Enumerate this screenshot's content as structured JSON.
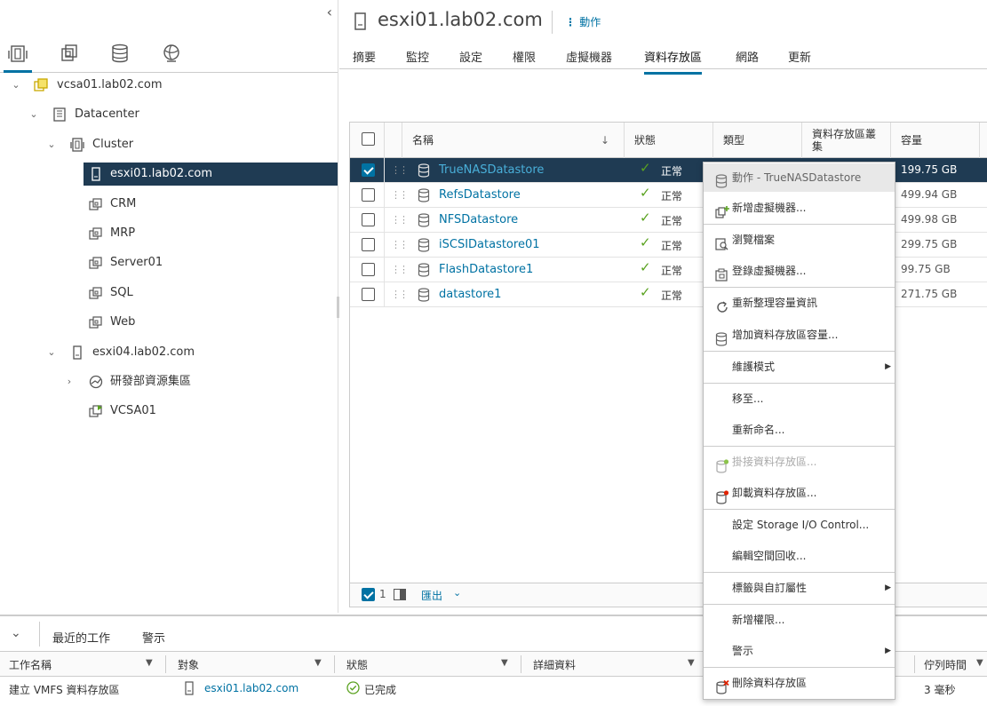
{
  "header": {
    "title": "esxi01.lab02.com",
    "actions_label": "動作"
  },
  "main_tabs": [
    "摘要",
    "監控",
    "設定",
    "權限",
    "虛擬機器",
    "資料存放區",
    "網路",
    "更新"
  ],
  "active_tab": "資料存放區",
  "tree": [
    {
      "label": "vcsa01.lab02.com",
      "icon": "vcenter-icon",
      "level": 0,
      "expanded": true
    },
    {
      "label": "Datacenter",
      "icon": "datacenter-icon",
      "level": 1,
      "expanded": true
    },
    {
      "label": "Cluster",
      "icon": "cluster-icon",
      "level": 2,
      "expanded": true
    },
    {
      "label": "esxi01.lab02.com",
      "icon": "host-icon",
      "level": 3,
      "selected": true
    },
    {
      "label": "CRM",
      "icon": "vm-icon",
      "level": 3
    },
    {
      "label": "MRP",
      "icon": "vm-icon",
      "level": 3
    },
    {
      "label": "Server01",
      "icon": "vm-icon",
      "level": 3
    },
    {
      "label": "SQL",
      "icon": "vm-icon",
      "level": 3
    },
    {
      "label": "Web",
      "icon": "vm-icon",
      "level": 3
    },
    {
      "label": "esxi04.lab02.com",
      "icon": "host-icon",
      "level": 2,
      "expanded": true
    },
    {
      "label": "研發部資源集區",
      "icon": "resource-pool-icon",
      "level": 3,
      "collapsed": true
    },
    {
      "label": "VCSA01",
      "icon": "vm-powered-on-icon",
      "level": 3
    }
  ],
  "grid": {
    "columns": [
      "名稱",
      "狀態",
      "類型",
      "資料存放區叢集",
      "容量"
    ],
    "rows": [
      {
        "name": "TrueNASDatastore",
        "status": "正常",
        "capacity": "199.75 GB",
        "selected": true
      },
      {
        "name": "RefsDatastore",
        "status": "正常",
        "capacity": "499.94 GB"
      },
      {
        "name": "NFSDatastore",
        "status": "正常",
        "capacity": "499.98 GB"
      },
      {
        "name": "iSCSIDatastore01",
        "status": "正常",
        "capacity": "299.75 GB"
      },
      {
        "name": "FlashDatastore1",
        "status": "正常",
        "capacity": "99.75 GB"
      },
      {
        "name": "datastore1",
        "status": "正常",
        "capacity": "271.75 GB"
      }
    ],
    "footer": {
      "selected_count": "1",
      "export_label": "匯出"
    }
  },
  "context_menu": {
    "header": "動作 - TrueNASDatastore",
    "items": [
      {
        "label": "新增虛擬機器...",
        "icon": "new-vm-icon"
      },
      {
        "label": "瀏覽檔案",
        "icon": "browse-files-icon"
      },
      {
        "label": "登錄虛擬機器...",
        "icon": "register-vm-icon"
      },
      {
        "label": "重新整理容量資訊",
        "icon": "refresh-icon"
      },
      {
        "label": "增加資料存放區容量...",
        "icon": "datastore-icon"
      },
      {
        "label": "維護模式",
        "submenu": true
      },
      {
        "label": "移至..."
      },
      {
        "label": "重新命名..."
      },
      {
        "label": "掛接資料存放區...",
        "icon": "mount-datastore-icon",
        "disabled": true
      },
      {
        "label": "卸載資料存放區...",
        "icon": "unmount-datastore-icon"
      },
      {
        "label": "設定 Storage I/O Control..."
      },
      {
        "label": "編輯空間回收..."
      },
      {
        "label": "標籤與自訂屬性",
        "submenu": true
      },
      {
        "label": "新增權限..."
      },
      {
        "label": "警示",
        "submenu": true
      },
      {
        "label": "刪除資料存放區",
        "icon": "delete-datastore-icon"
      }
    ]
  },
  "tasks_panel": {
    "tabs": [
      "最近的工作",
      "警示"
    ],
    "active_tab": "最近的工作",
    "columns": [
      "工作名稱",
      "對象",
      "狀態",
      "詳細資料",
      "佇列時間"
    ],
    "rows": [
      {
        "task": "建立 VMFS 資料存放區",
        "target": "esxi01.lab02.com",
        "status": "已完成",
        "queue_time": "3 毫秒"
      }
    ]
  },
  "colors": {
    "accent": "#0072a3",
    "selection_bg": "#1f3b53",
    "link": "#0072a3",
    "ok_green": "#5aa220"
  }
}
